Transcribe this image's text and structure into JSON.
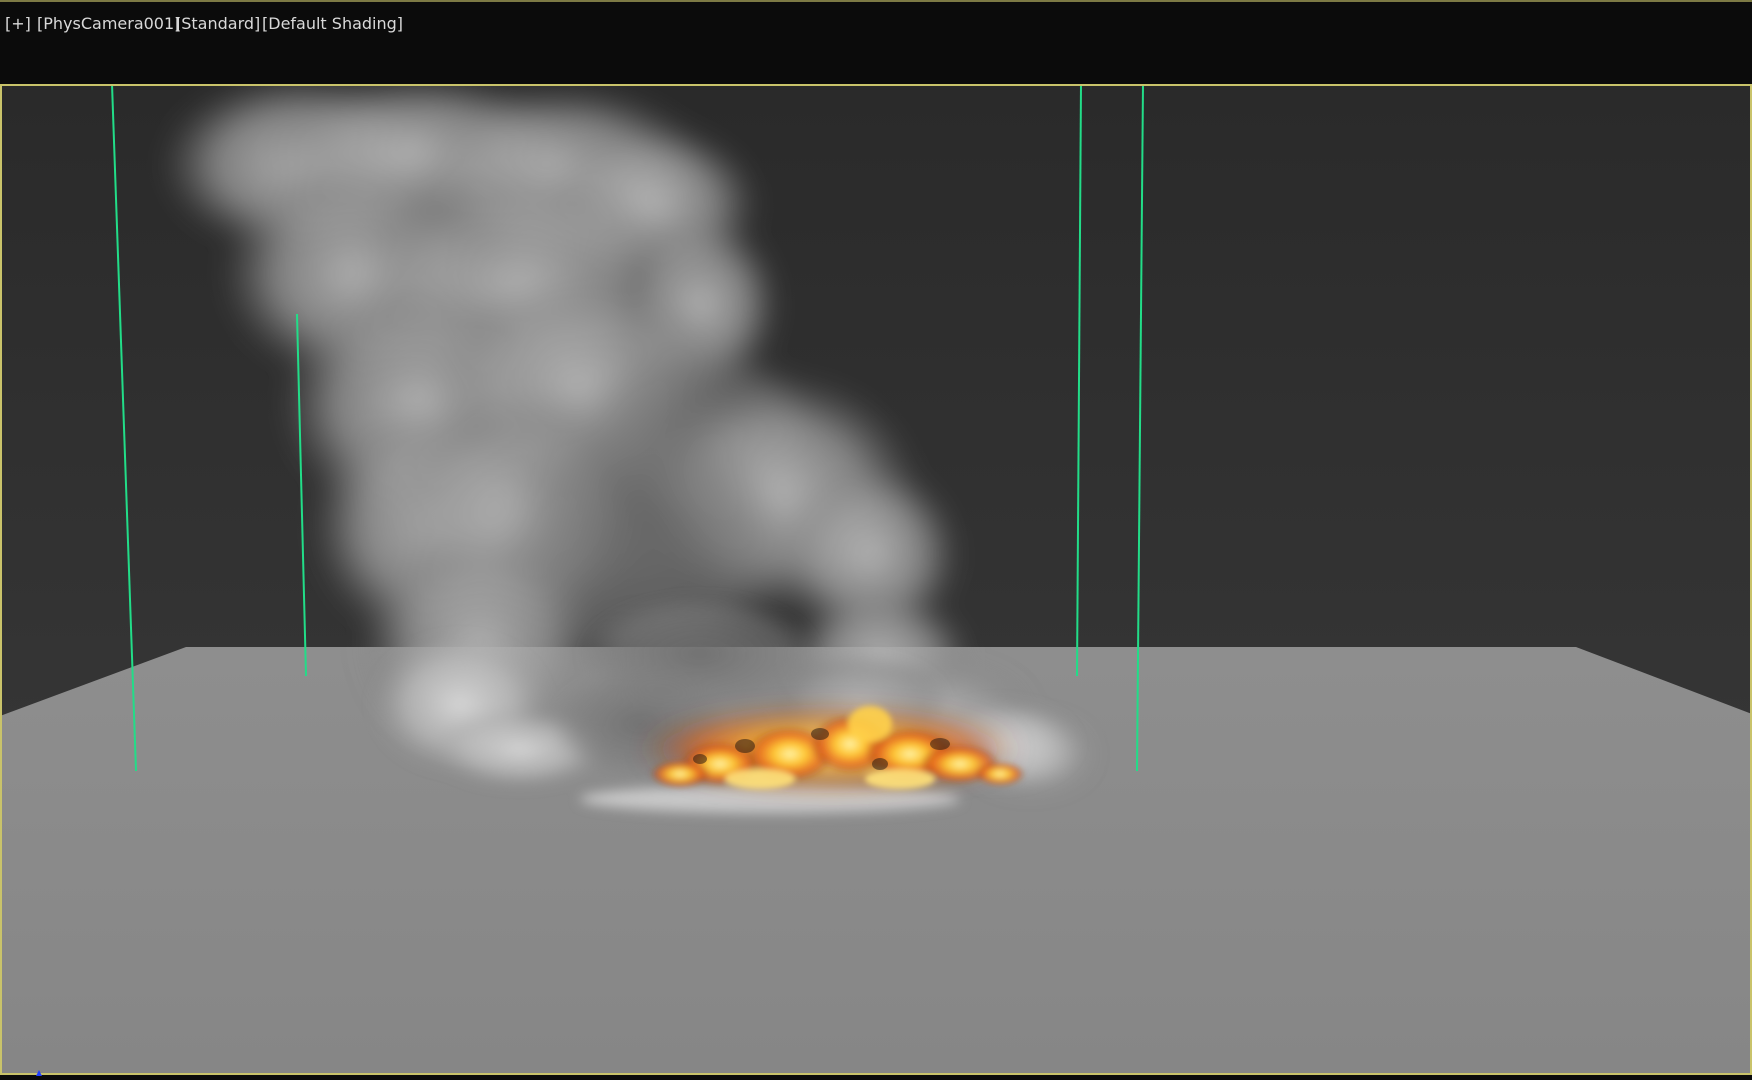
{
  "viewport": {
    "labels": {
      "plus": "[+]",
      "camera": "[PhysCamera001]",
      "render_mode": "[Standard]",
      "shading": "[Default Shading]"
    }
  },
  "colors": {
    "background_top": "#2b2b2b",
    "background_bottom": "#3c3c3c",
    "ground_plane": "#8a8a8a",
    "viewport_border": "#c9c36a",
    "gizmo_lines": "#22dd88",
    "fire_core": "#ffd24a",
    "fire_outer": "#e8661c",
    "smoke": "#9a9a9a"
  }
}
